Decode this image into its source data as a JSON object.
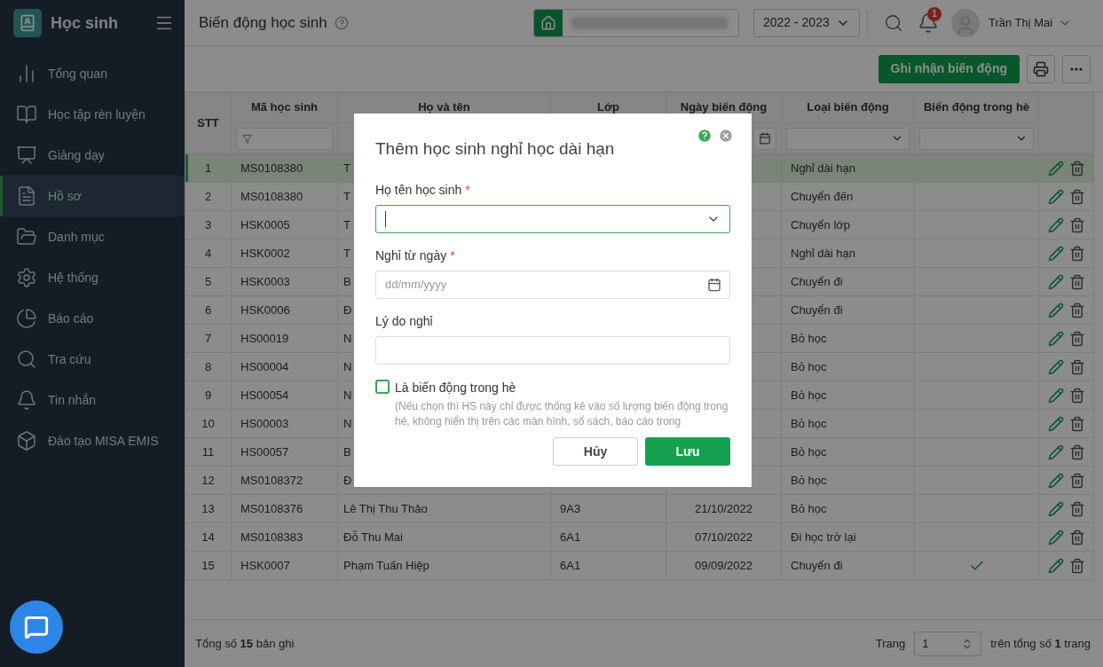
{
  "sidebar": {
    "app_title": "Học sinh",
    "items": [
      {
        "label": "Tổng quan",
        "selected": false
      },
      {
        "label": "Học tập rèn luyện",
        "selected": false
      },
      {
        "label": "Giảng dạy",
        "selected": false
      },
      {
        "label": "Hồ sơ",
        "selected": true
      },
      {
        "label": "Danh mục",
        "selected": false
      },
      {
        "label": "Hệ thống",
        "selected": false
      },
      {
        "label": "Báo cáo",
        "selected": false
      },
      {
        "label": "Tra cứu",
        "selected": false
      },
      {
        "label": "Tin nhắn",
        "selected": false
      },
      {
        "label": "Đào tạo MISA EMIS",
        "selected": false
      }
    ]
  },
  "header": {
    "title": "Biến động học sinh",
    "year": "2022 - 2023",
    "notification_count": "1",
    "user_name": "Trần Thị Mai"
  },
  "toolbar": {
    "primary_button": "Ghi nhận biến động"
  },
  "table": {
    "columns": [
      "STT",
      "Mã học sinh",
      "Họ và tên",
      "Lớp",
      "Ngày biến động",
      "Loại biến động",
      "Biến động trong hè"
    ],
    "rows": [
      {
        "stt": "1",
        "code": "MS0108380",
        "name": "T",
        "type": "Nghỉ dài hạn",
        "summer": false,
        "selected": true
      },
      {
        "stt": "2",
        "code": "MS0108380",
        "name": "T",
        "type": "Chuyển đến",
        "summer": false,
        "selected": false
      },
      {
        "stt": "3",
        "code": "HSK0005",
        "name": "T",
        "type": "Chuyển lớp",
        "summer": false,
        "selected": false
      },
      {
        "stt": "4",
        "code": "HSK0002",
        "name": "T",
        "type": "Nghỉ dài hạn",
        "summer": false,
        "selected": false
      },
      {
        "stt": "5",
        "code": "HSK0003",
        "name": "B",
        "type": "Chuyển đi",
        "summer": false,
        "selected": false
      },
      {
        "stt": "6",
        "code": "HSK0006",
        "name": "Đ",
        "type": "Chuyển đi",
        "summer": false,
        "selected": false
      },
      {
        "stt": "7",
        "code": "HS00019",
        "name": "N",
        "type": "Bỏ học",
        "summer": false,
        "selected": false
      },
      {
        "stt": "8",
        "code": "HS00004",
        "name": "N",
        "type": "Bỏ học",
        "summer": false,
        "selected": false
      },
      {
        "stt": "9",
        "code": "HS00054",
        "name": "N",
        "type": "Bỏ học",
        "summer": false,
        "selected": false
      },
      {
        "stt": "10",
        "code": "HS00003",
        "name": "N",
        "type": "Bỏ học",
        "summer": false,
        "selected": false
      },
      {
        "stt": "11",
        "code": "HS00057",
        "name": "B",
        "type": "Bỏ học",
        "summer": false,
        "selected": false
      },
      {
        "stt": "12",
        "code": "MS0108372",
        "name": "Đ",
        "type": "Bỏ học",
        "summer": false,
        "selected": false
      },
      {
        "stt": "13",
        "code": "MS0108376",
        "name": "Lê Thị Thu Thảo",
        "class": "9A3",
        "date": "21/10/2022",
        "type": "Bỏ học",
        "summer": false,
        "selected": false
      },
      {
        "stt": "14",
        "code": "MS0108383",
        "name": "Đỗ Thu Mai",
        "class": "6A1",
        "date": "07/10/2022",
        "type": "Đi học trở lại",
        "summer": false,
        "selected": false
      },
      {
        "stt": "15",
        "code": "HSK0007",
        "name": "Phạm Tuấn Hiệp",
        "class": "6A1",
        "date": "09/09/2022",
        "type": "Chuyển đi",
        "summer": true,
        "selected": false
      }
    ]
  },
  "footer": {
    "total": "Tổng số **15** bản ghi",
    "page_label": "Trang",
    "page": "1",
    "page_total": "trên tổng số **1** trang"
  },
  "dialog": {
    "title": "Thêm học sinh nghỉ học dài hạn",
    "fields": [
      {
        "kind": "combo",
        "label": "Họ tên học sinh",
        "required_mark": "*",
        "focused": true
      },
      {
        "kind": "date",
        "label": "Nghỉ từ ngày",
        "required_mark": "*",
        "focused": false,
        "placeholder": "dd/mm/yyyy"
      },
      {
        "kind": "text",
        "label": "Lý do nghỉ",
        "focused": false
      }
    ],
    "checkbox": {
      "label": "Là biến động trong hè",
      "checked": false,
      "hint": "(Nếu chọn thì HS này chỉ được thống kê vào số lượng biến động trong hè, không hiển thị trên các màn hình, sổ sách, báo cáo trong"
    },
    "cancel": "Hủy",
    "save": "Lưu"
  }
}
